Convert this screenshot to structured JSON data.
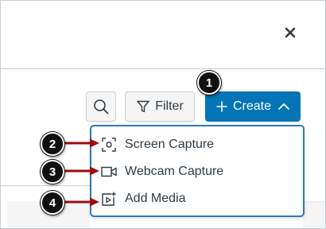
{
  "window": {
    "close_icon": "close-icon"
  },
  "toolbar": {
    "search_icon": "search-icon",
    "filter_label": "Filter",
    "filter_icon": "filter-icon",
    "create_label": "Create",
    "create_icon": "plus-icon",
    "create_chevron": "chevron-up-icon",
    "accent_color": "#0374b5"
  },
  "menu": {
    "border_color": "#2b7abc",
    "items": [
      {
        "label": "Screen Capture",
        "icon": "screen-capture-icon"
      },
      {
        "label": "Webcam Capture",
        "icon": "webcam-icon"
      },
      {
        "label": "Add Media",
        "icon": "add-media-icon"
      }
    ]
  },
  "callouts": [
    {
      "number": "1",
      "arrow_color": "#9b0d0d"
    },
    {
      "number": "2"
    },
    {
      "number": "3"
    },
    {
      "number": "4"
    }
  ]
}
